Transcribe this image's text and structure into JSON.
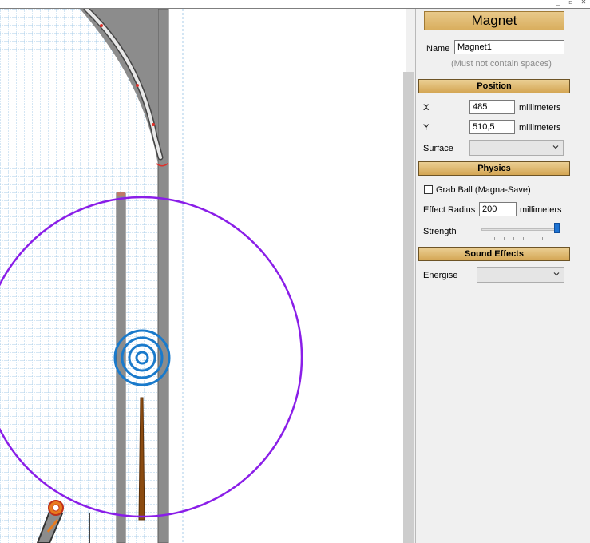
{
  "window": {
    "minimize_glyph": "_",
    "restore_glyph": "▫",
    "close_glyph": "✕"
  },
  "panel": {
    "title": "Magnet",
    "name": {
      "label": "Name",
      "value": "Magnet1",
      "hint": "(Must not contain spaces)"
    },
    "position": {
      "header": "Position",
      "x": {
        "label": "X",
        "value": "485",
        "unit": "millimeters"
      },
      "y": {
        "label": "Y",
        "value": "510,5",
        "unit": "millimeters"
      },
      "surface": {
        "label": "Surface",
        "value": ""
      }
    },
    "physics": {
      "header": "Physics",
      "grab_ball": {
        "label": "Grab Ball (Magna-Save)",
        "checked": false
      },
      "effect_radius": {
        "label": "Effect Radius",
        "value": "200",
        "unit": "millimeters"
      },
      "strength": {
        "label": "Strength",
        "level": 1.0
      }
    },
    "sound_effects": {
      "header": "Sound Effects",
      "energise": {
        "label": "Energise",
        "value": ""
      }
    }
  },
  "canvas": {
    "colors": {
      "grid": "#a9cde9",
      "rail": "#8c8c8c",
      "effect_circle": "#8a1ee8",
      "magnet": "#1a7acb",
      "plunger": "#8b4b10",
      "marker": "#e0302a"
    }
  }
}
